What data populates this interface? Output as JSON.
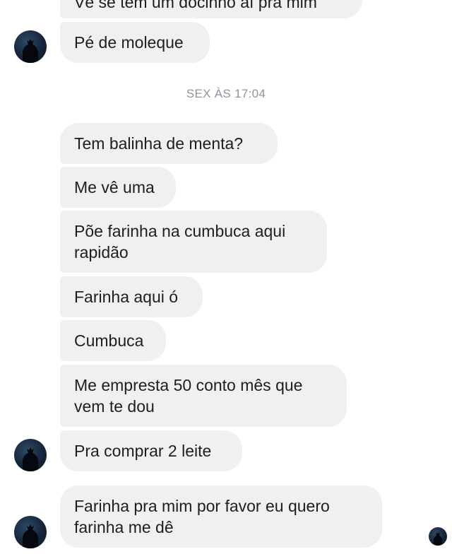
{
  "thread": {
    "cut_message": "Vê se tem um docinho aí pra mim",
    "messages": [
      {
        "text": "Pé de moleque"
      },
      {
        "text": "Tem balinha de menta?"
      },
      {
        "text": "Me vê uma"
      },
      {
        "text": "Põe farinha na cumbuca aqui rapidão"
      },
      {
        "text": "Farinha aqui ó"
      },
      {
        "text": "Cumbuca"
      },
      {
        "text": "Me empresta 50 conto mês que vem te dou"
      },
      {
        "text": "Pra comprar 2 leite"
      },
      {
        "text": "Farinha pra mim por favor eu quero farinha me dê"
      }
    ],
    "timestamp": "SEX ÀS 17:04"
  },
  "icons": {
    "avatar": "person-silhouette-icon",
    "seen_indicator": "seen-avatar-icon"
  },
  "colors": {
    "bubble": "#f0f0f0",
    "text": "#1c1e21",
    "timestamp": "#8d949e"
  }
}
